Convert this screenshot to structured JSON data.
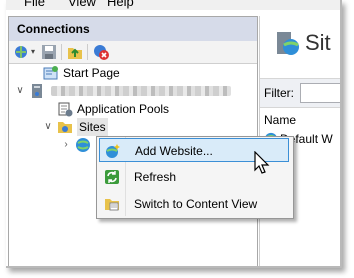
{
  "menu": {
    "file": "File",
    "view": "View",
    "help": "Help"
  },
  "connections": {
    "header": "Connections",
    "tree": {
      "start_page": "Start Page",
      "app_pools": "Application Pools",
      "sites": "Sites"
    }
  },
  "right": {
    "title": "Sit",
    "filter_label": "Filter:",
    "name_col": "Name",
    "row_default": "Default W"
  },
  "context_menu": {
    "add_website": "Add Website...",
    "refresh": "Refresh",
    "switch_content": "Switch to Content View"
  },
  "colors": {
    "header_bg": "#d6dbe9",
    "highlight": "#d9ebf9",
    "highlight_border": "#3b8fd6"
  }
}
